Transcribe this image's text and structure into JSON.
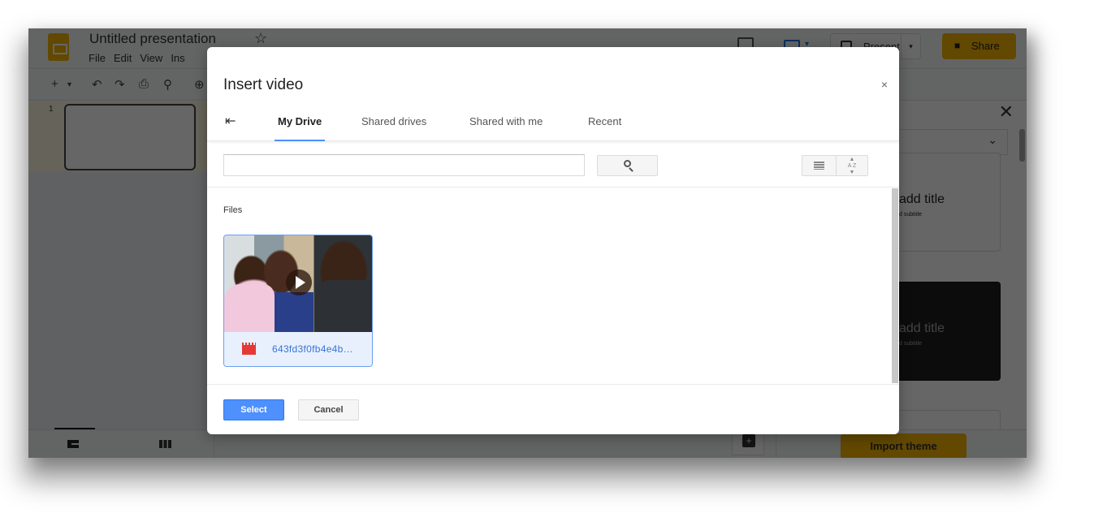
{
  "app": {
    "title": "Untitled presentation",
    "star_icon": "☆",
    "menu": [
      "File",
      "Edit",
      "View",
      "Ins"
    ],
    "present_label": "Present",
    "share_label": "Share",
    "lock_icon": "🔒",
    "toolbar_icons": [
      "+",
      "▾",
      "↶",
      "↷",
      "⎙",
      "⚲",
      "⊕"
    ],
    "slide_number": "1",
    "themes": {
      "close_icon": "✕",
      "chevron_icon": "⌄",
      "card_title": "add title",
      "card_subtitle": "d subtitle",
      "import_label": "Import theme"
    }
  },
  "dialog": {
    "title": "Insert video",
    "close_icon": "×",
    "back_icon": "⇤",
    "tabs": [
      {
        "label": "My Drive",
        "active": true
      },
      {
        "label": "Shared drives",
        "active": false
      },
      {
        "label": "Shared with me",
        "active": false
      },
      {
        "label": "Recent",
        "active": false
      }
    ],
    "search": {
      "value": "",
      "placeholder": ""
    },
    "sort_icon": "A↕Z",
    "files_label": "Files",
    "files": [
      {
        "name": "643fd3f0fb4e4b…",
        "type": "video",
        "selected": true
      }
    ],
    "select_label": "Select",
    "cancel_label": "Cancel"
  },
  "colors": {
    "accent_blue": "#4d90fe",
    "slides_yellow": "#f4b400",
    "file_link": "#3b73d6",
    "video_icon_red": "#e53935"
  }
}
